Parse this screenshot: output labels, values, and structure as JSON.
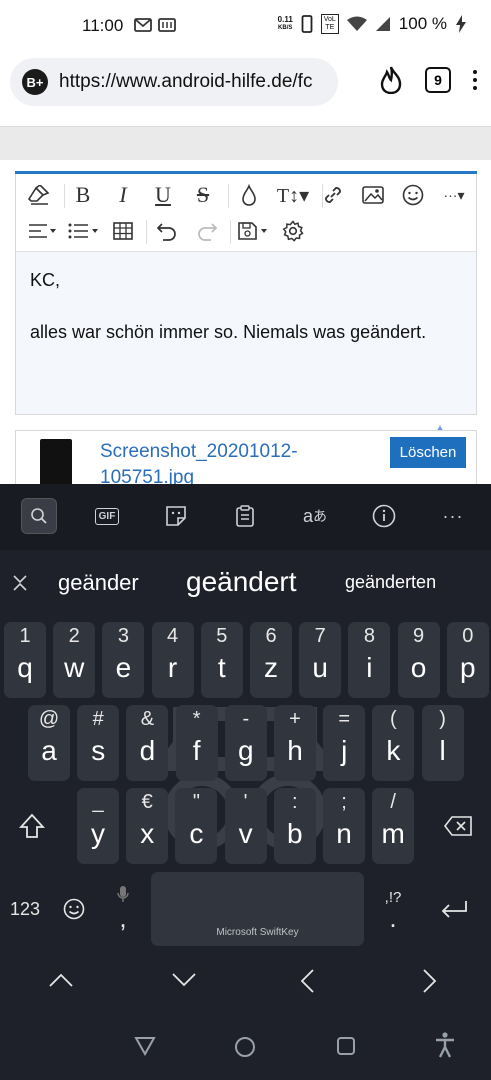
{
  "status_bar": {
    "time": "11:00",
    "net_speed_value": "0.11",
    "net_speed_unit": "KB/S",
    "volte": "VoLTE",
    "battery": "100 %"
  },
  "browser": {
    "url": "https://www.android-hilfe.de/fc",
    "site_badge": "B+",
    "tab_count": "9"
  },
  "editor": {
    "content_line1": "KC,",
    "content_line2": "alles war schön immer so. Niemals was geändert.",
    "accent_color": "#2577c8"
  },
  "attachment": {
    "filename_line1": "Screenshot_20201012-",
    "filename_line2": "105751.jpg",
    "delete_label": "Löschen"
  },
  "keyboard": {
    "toolbar": {
      "gif_label": "GIF"
    },
    "suggestions": [
      "geänder",
      "geändert",
      "geänderten"
    ],
    "row1": [
      {
        "h": "1",
        "k": "q"
      },
      {
        "h": "2",
        "k": "w"
      },
      {
        "h": "3",
        "k": "e"
      },
      {
        "h": "4",
        "k": "r"
      },
      {
        "h": "5",
        "k": "t"
      },
      {
        "h": "6",
        "k": "z"
      },
      {
        "h": "7",
        "k": "u"
      },
      {
        "h": "8",
        "k": "i"
      },
      {
        "h": "9",
        "k": "o"
      },
      {
        "h": "0",
        "k": "p"
      }
    ],
    "row2": [
      {
        "h": "@",
        "k": "a"
      },
      {
        "h": "#",
        "k": "s"
      },
      {
        "h": "&",
        "k": "d"
      },
      {
        "h": "*",
        "k": "f"
      },
      {
        "h": "-",
        "k": "g"
      },
      {
        "h": "+",
        "k": "h"
      },
      {
        "h": "=",
        "k": "j"
      },
      {
        "h": "(",
        "k": "k"
      },
      {
        "h": ")",
        "k": "l"
      }
    ],
    "row3": [
      {
        "h": "_",
        "k": "y"
      },
      {
        "h": "€",
        "k": "x"
      },
      {
        "h": "\"",
        "k": "c"
      },
      {
        "h": "'",
        "k": "v"
      },
      {
        "h": ":",
        "k": "b"
      },
      {
        "h": ";",
        "k": "n"
      },
      {
        "h": "/",
        "k": "m"
      }
    ],
    "numbers_label": "123",
    "comma_label": ",",
    "period_hint": ",!?",
    "period_label": ".",
    "space_label": "Microsoft SwiftKey"
  }
}
